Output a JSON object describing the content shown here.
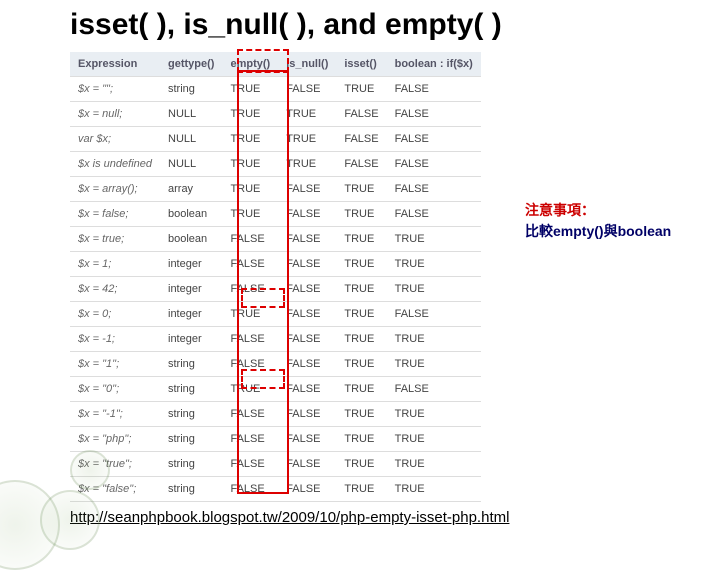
{
  "title": "isset( ), is_null( ), and empty( )",
  "headers": [
    "Expression",
    "gettype()",
    "empty()",
    "is_null()",
    "isset()",
    "boolean : if($x)"
  ],
  "rows": [
    {
      "expr": "$x = \"\";",
      "gettype": "string",
      "empty": "TRUE",
      "isnull": "FALSE",
      "isset": "TRUE",
      "bool": "FALSE"
    },
    {
      "expr": "$x = null;",
      "gettype": "NULL",
      "empty": "TRUE",
      "isnull": "TRUE",
      "isset": "FALSE",
      "bool": "FALSE"
    },
    {
      "expr": "var $x;",
      "gettype": "NULL",
      "empty": "TRUE",
      "isnull": "TRUE",
      "isset": "FALSE",
      "bool": "FALSE"
    },
    {
      "expr": "$x is undefined",
      "gettype": "NULL",
      "empty": "TRUE",
      "isnull": "TRUE",
      "isset": "FALSE",
      "bool": "FALSE"
    },
    {
      "expr": "$x = array();",
      "gettype": "array",
      "empty": "TRUE",
      "isnull": "FALSE",
      "isset": "TRUE",
      "bool": "FALSE"
    },
    {
      "expr": "$x = false;",
      "gettype": "boolean",
      "empty": "TRUE",
      "isnull": "FALSE",
      "isset": "TRUE",
      "bool": "FALSE"
    },
    {
      "expr": "$x = true;",
      "gettype": "boolean",
      "empty": "FALSE",
      "isnull": "FALSE",
      "isset": "TRUE",
      "bool": "TRUE"
    },
    {
      "expr": "$x = 1;",
      "gettype": "integer",
      "empty": "FALSE",
      "isnull": "FALSE",
      "isset": "TRUE",
      "bool": "TRUE"
    },
    {
      "expr": "$x = 42;",
      "gettype": "integer",
      "empty": "FALSE",
      "isnull": "FALSE",
      "isset": "TRUE",
      "bool": "TRUE"
    },
    {
      "expr": "$x = 0;",
      "gettype": "integer",
      "empty": "TRUE",
      "isnull": "FALSE",
      "isset": "TRUE",
      "bool": "FALSE"
    },
    {
      "expr": "$x = -1;",
      "gettype": "integer",
      "empty": "FALSE",
      "isnull": "FALSE",
      "isset": "TRUE",
      "bool": "TRUE"
    },
    {
      "expr": "$x = \"1\";",
      "gettype": "string",
      "empty": "FALSE",
      "isnull": "FALSE",
      "isset": "TRUE",
      "bool": "TRUE"
    },
    {
      "expr": "$x = \"0\";",
      "gettype": "string",
      "empty": "TRUE",
      "isnull": "FALSE",
      "isset": "TRUE",
      "bool": "FALSE"
    },
    {
      "expr": "$x = \"-1\";",
      "gettype": "string",
      "empty": "FALSE",
      "isnull": "FALSE",
      "isset": "TRUE",
      "bool": "TRUE"
    },
    {
      "expr": "$x = \"php\";",
      "gettype": "string",
      "empty": "FALSE",
      "isnull": "FALSE",
      "isset": "TRUE",
      "bool": "TRUE"
    },
    {
      "expr": "$x = \"true\";",
      "gettype": "string",
      "empty": "FALSE",
      "isnull": "FALSE",
      "isset": "TRUE",
      "bool": "TRUE"
    },
    {
      "expr": "$x = \"false\";",
      "gettype": "string",
      "empty": "FALSE",
      "isnull": "FALSE",
      "isset": "TRUE",
      "bool": "TRUE"
    }
  ],
  "annotation": {
    "line1": "注意事項：",
    "line2_a": "比較",
    "line2_b": "empty()",
    "line2_c": "與",
    "line2_d": "boolean"
  },
  "footer_url": "http://seanphpbook.blogspot.tw/2009/10/php-empty-isset-php.html"
}
